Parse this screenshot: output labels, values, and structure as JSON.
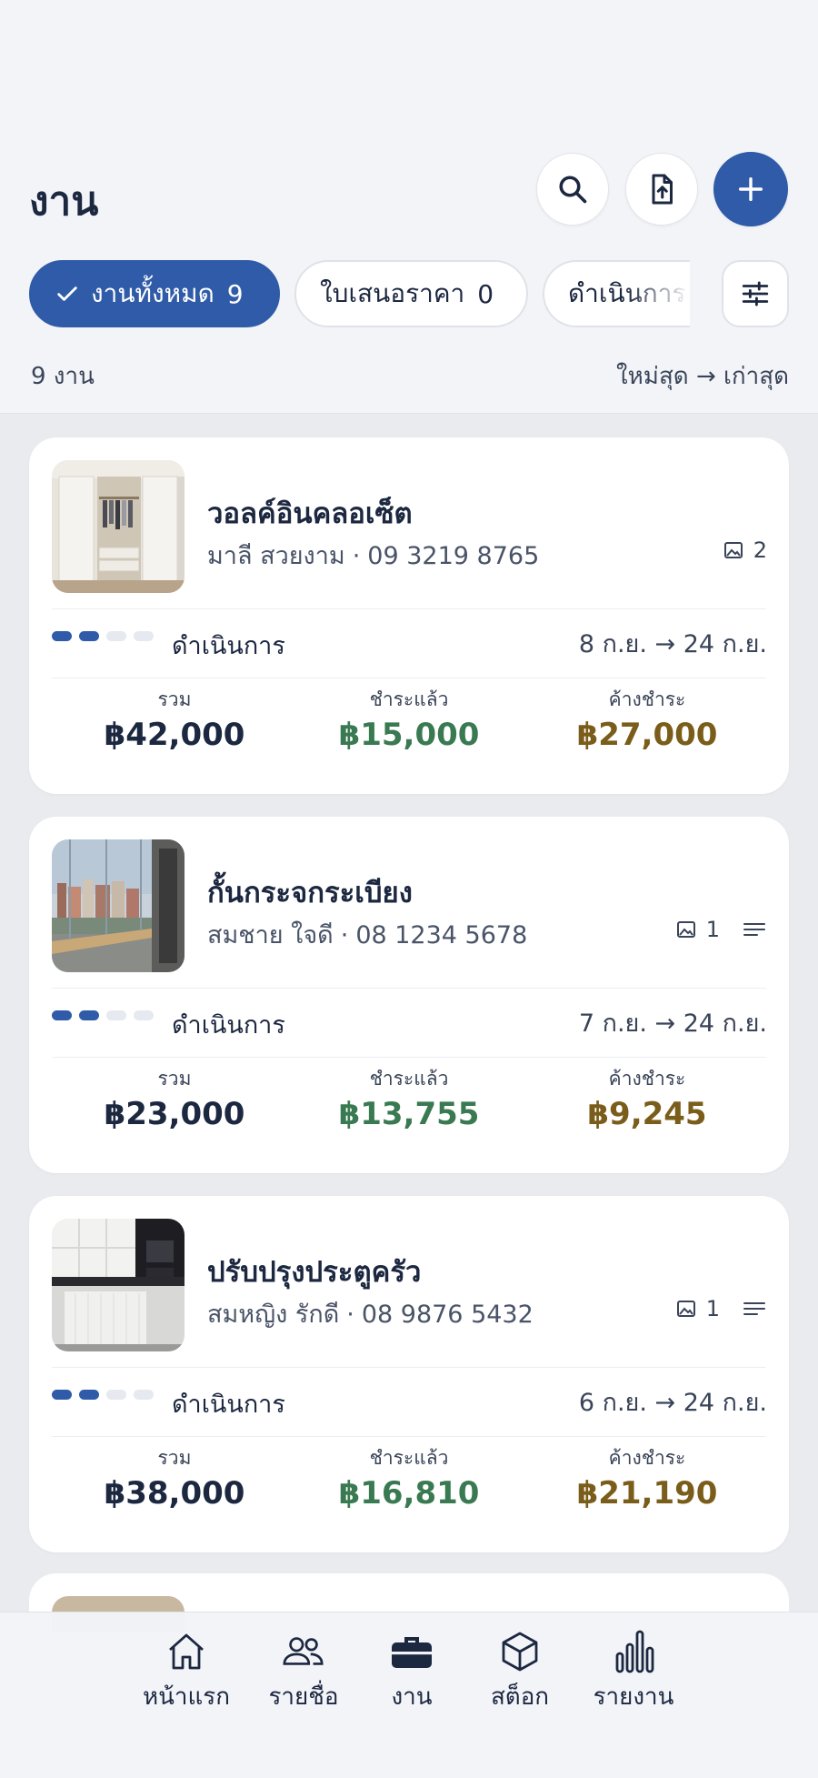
{
  "header": {
    "title": "งาน"
  },
  "filters": [
    {
      "label": "งานทั้งหมด",
      "count": "9",
      "active": true
    },
    {
      "label": "ใบเสนอราคา",
      "count": "0",
      "active": false
    },
    {
      "label": "ดำเนินการ",
      "count": "",
      "active": false
    }
  ],
  "summary": {
    "count_text": "9 งาน",
    "sort_text": "ใหม่สุด → เก่าสุด"
  },
  "money_labels": {
    "total": "รวม",
    "paid": "ชำระแล้ว",
    "due": "ค้างชำระ"
  },
  "jobs": [
    {
      "title": "วอลค์อินคลอเซ็ต",
      "customer": "มาลี สวยงาม",
      "phone": "09 3219 8765",
      "images": "2",
      "has_notes": false,
      "progress_steps": 4,
      "progress_done": 2,
      "status": "ดำเนินการ",
      "date_range": "8 ก.ย. → 24 ก.ย.",
      "total": "฿42,000",
      "paid": "฿15,000",
      "due": "฿27,000"
    },
    {
      "title": "กั้นกระจกระเบียง",
      "customer": "สมชาย ใจดี",
      "phone": "08 1234 5678",
      "images": "1",
      "has_notes": true,
      "progress_steps": 4,
      "progress_done": 2,
      "status": "ดำเนินการ",
      "date_range": "7 ก.ย. → 24 ก.ย.",
      "total": "฿23,000",
      "paid": "฿13,755",
      "due": "฿9,245"
    },
    {
      "title": "ปรับปรุงประตูครัว",
      "customer": "สมหญิง รักดี",
      "phone": "08 9876 5432",
      "images": "1",
      "has_notes": true,
      "progress_steps": 4,
      "progress_done": 2,
      "status": "ดำเนินการ",
      "date_range": "6 ก.ย. → 24 ก.ย.",
      "total": "฿38,000",
      "paid": "฿16,810",
      "due": "฿21,190"
    }
  ],
  "nav": [
    {
      "label": "หน้าแรก",
      "icon": "home-icon",
      "active": false
    },
    {
      "label": "รายชื่อ",
      "icon": "people-icon",
      "active": false
    },
    {
      "label": "งาน",
      "icon": "briefcase-icon",
      "active": true
    },
    {
      "label": "สต็อก",
      "icon": "box-icon",
      "active": false
    },
    {
      "label": "รายงาน",
      "icon": "bar-chart-icon",
      "active": false
    }
  ],
  "colors": {
    "accent": "#2f5ba8",
    "paid": "#3a7a52",
    "due": "#7a5d1a",
    "text": "#1c2740"
  }
}
